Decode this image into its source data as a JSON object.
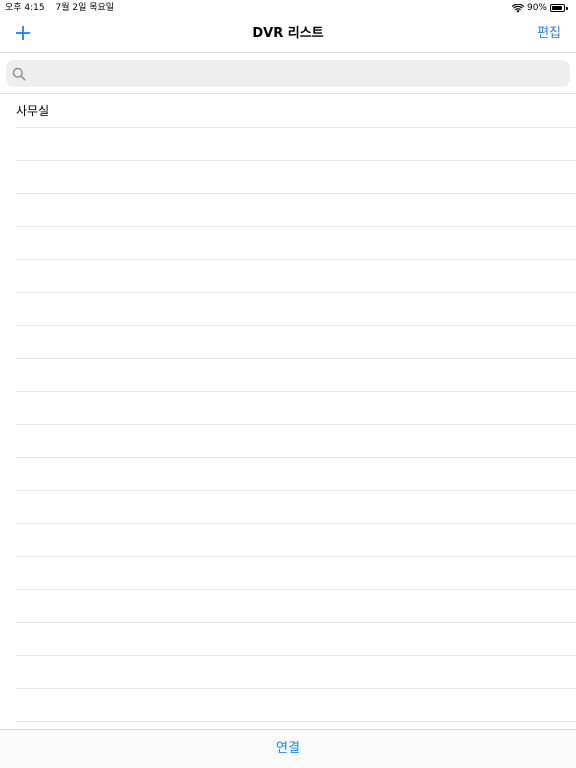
{
  "status_bar": {
    "time": "오후 4:15",
    "date": "7월 2일 목요일",
    "battery_percent": "90%",
    "battery_level": 0.9,
    "icons": [
      "wifi-icon",
      "battery-icon"
    ]
  },
  "nav": {
    "title": "DVR 리스트",
    "add_icon": "plus-icon",
    "edit_label": "편집"
  },
  "search": {
    "placeholder": "",
    "value": "",
    "icon": "search-icon"
  },
  "list": {
    "items": [
      {
        "label": "사무실"
      },
      {
        "label": ""
      },
      {
        "label": ""
      },
      {
        "label": ""
      },
      {
        "label": ""
      },
      {
        "label": ""
      },
      {
        "label": ""
      },
      {
        "label": ""
      },
      {
        "label": ""
      },
      {
        "label": ""
      },
      {
        "label": ""
      },
      {
        "label": ""
      },
      {
        "label": ""
      },
      {
        "label": ""
      },
      {
        "label": ""
      },
      {
        "label": ""
      },
      {
        "label": ""
      },
      {
        "label": ""
      },
      {
        "label": ""
      },
      {
        "label": ""
      }
    ]
  },
  "bottom_bar": {
    "connect_label": "연결"
  },
  "colors": {
    "accent": "#1a82fb",
    "separator": "#e6e6e8",
    "search_bg": "#eeeeef"
  }
}
